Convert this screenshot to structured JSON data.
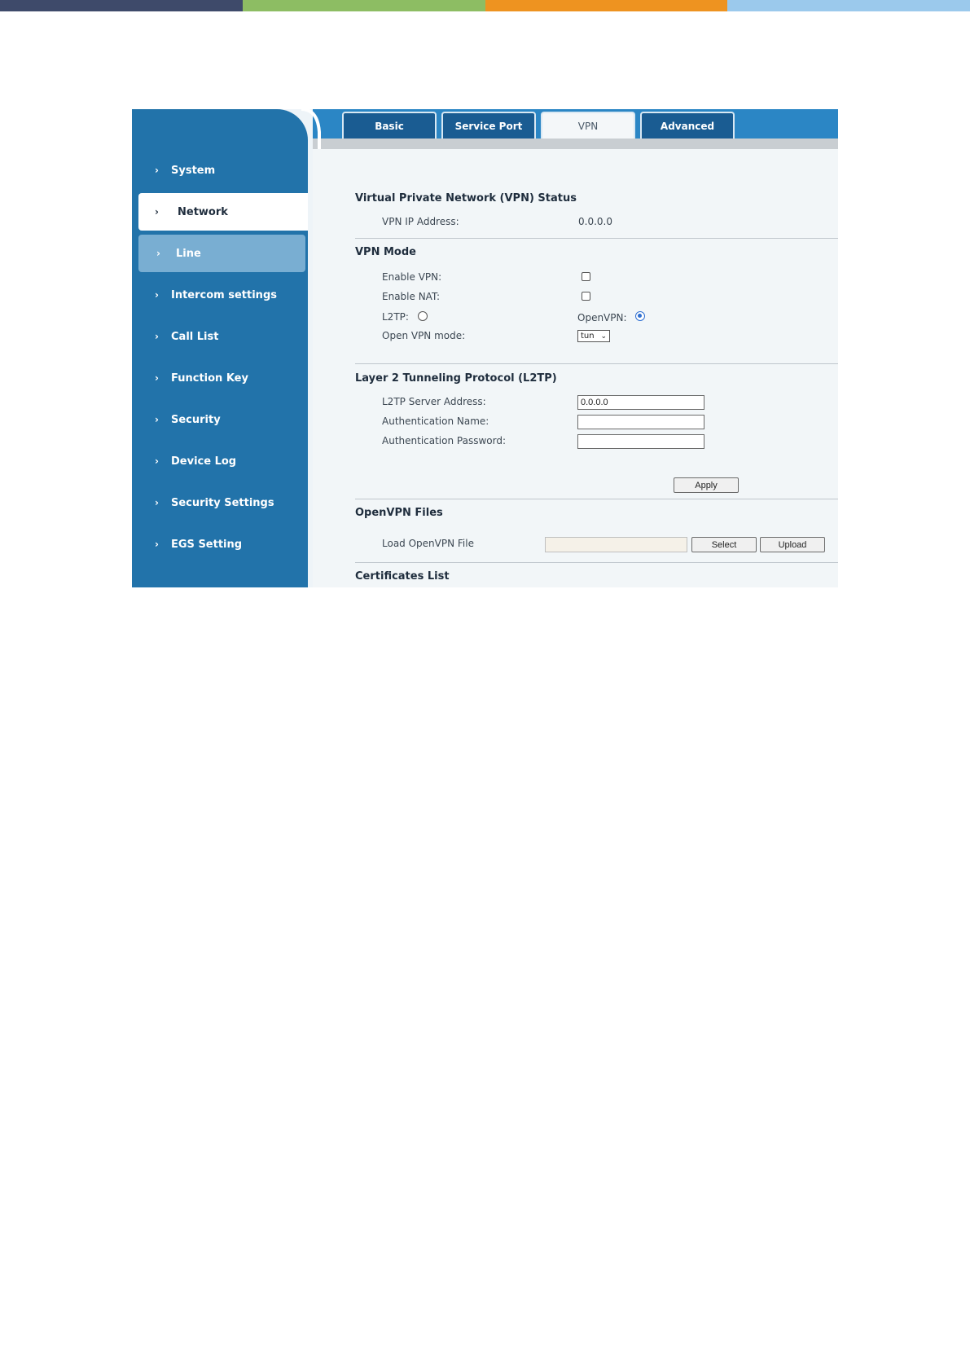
{
  "colors": {
    "stripe": [
      "#3e4a6a",
      "#8dbd63",
      "#ee9320",
      "#9bc9ec"
    ],
    "sidebar": "#2273aa",
    "tab_active_bg": "#f4f7f9",
    "tab_bg": "#1a5c92",
    "radio_checked": "#2f6fd1"
  },
  "sidebar": {
    "items": [
      {
        "label": "System",
        "icon": "chevron-right-icon"
      },
      {
        "label": "Network",
        "icon": "chevron-right-icon",
        "state": "selected"
      },
      {
        "label": "Line",
        "icon": "chevron-right-icon",
        "state": "hover"
      },
      {
        "label": "Intercom settings",
        "icon": "chevron-right-icon"
      },
      {
        "label": "Call List",
        "icon": "chevron-right-icon"
      },
      {
        "label": "Function Key",
        "icon": "chevron-right-icon"
      },
      {
        "label": "Security",
        "icon": "chevron-right-icon"
      },
      {
        "label": "Device Log",
        "icon": "chevron-right-icon"
      },
      {
        "label": "Security Settings",
        "icon": "chevron-right-icon"
      },
      {
        "label": "EGS Setting",
        "icon": "chevron-right-icon"
      }
    ]
  },
  "tabs": [
    {
      "label": "Basic"
    },
    {
      "label": "Service Port"
    },
    {
      "label": "VPN",
      "active": true
    },
    {
      "label": "Advanced"
    }
  ],
  "status": {
    "title": "Virtual Private Network (VPN) Status",
    "ip_label": "VPN IP Address:",
    "ip_value": "0.0.0.0"
  },
  "mode": {
    "title": "VPN Mode",
    "enable_vpn_label": "Enable VPN:",
    "enable_vpn": false,
    "enable_nat_label": "Enable NAT:",
    "enable_nat": false,
    "l2tp_label": "L2TP:",
    "l2tp_selected": false,
    "openvpn_label": "OpenVPN:",
    "openvpn_selected": true,
    "openvpn_mode_label": "Open VPN mode:",
    "openvpn_mode_value": "tun"
  },
  "l2tp": {
    "title": "Layer 2 Tunneling Protocol (L2TP)",
    "server_label": "L2TP Server Address:",
    "server_value": "0.0.0.0",
    "auth_name_label": "Authentication Name:",
    "auth_name_value": "",
    "auth_password_label": "Authentication Password:",
    "auth_password_value": "",
    "apply_label": "Apply"
  },
  "openvpn_files": {
    "title": "OpenVPN Files",
    "load_label": "Load OpenVPN File",
    "file_value": "",
    "select_label": "Select",
    "upload_label": "Upload"
  },
  "certificates": {
    "title": "Certificates List"
  }
}
